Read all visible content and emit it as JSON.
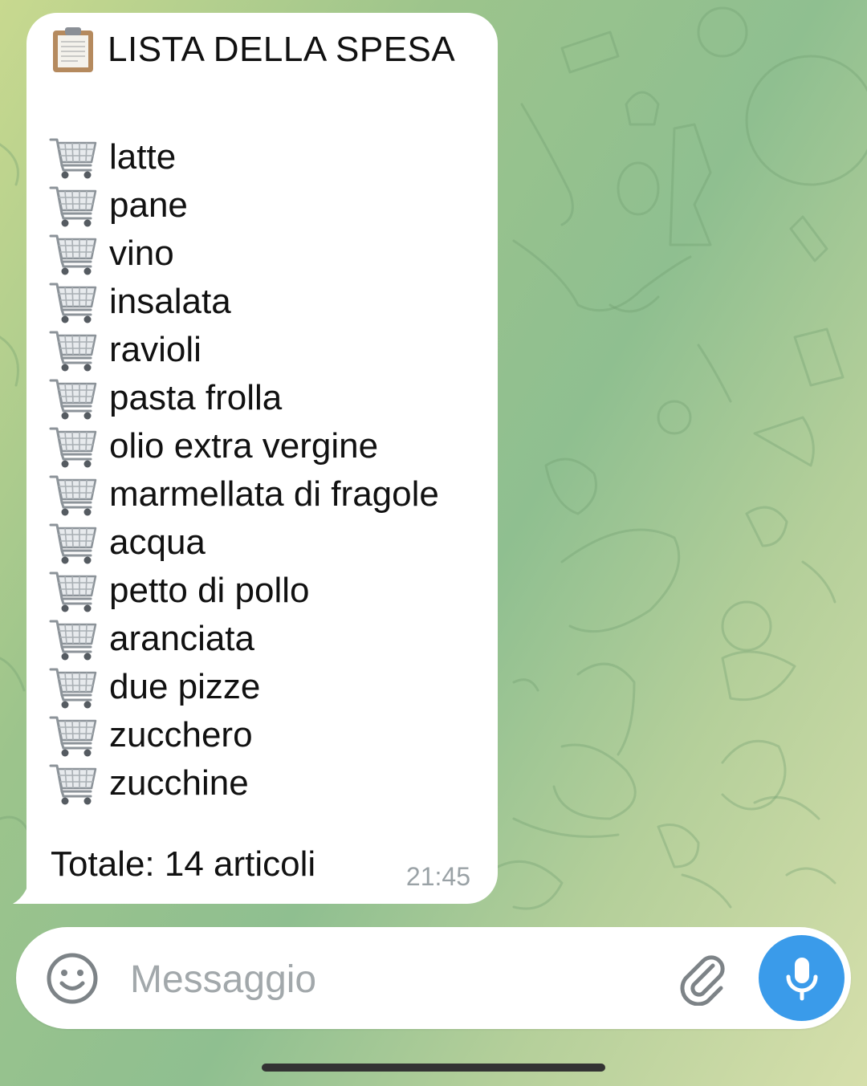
{
  "message": {
    "title": "LISTA DELLA SPESA",
    "title_icon": "clipboard-icon",
    "item_icon": "shopping-cart-icon",
    "items": [
      "latte",
      "pane",
      "vino",
      "insalata",
      "ravioli",
      "pasta frolla",
      "olio extra vergine",
      "marmellata di fragole",
      "acqua",
      "petto di pollo",
      "aranciata",
      "due pizze",
      "zucchero",
      "zucchine"
    ],
    "total": "Totale: 14 articoli",
    "time": "21:45"
  },
  "composer": {
    "placeholder": "Messaggio",
    "emoji_icon": "smiley-icon",
    "attach_icon": "paperclip-icon",
    "send_icon": "microphone-icon"
  },
  "colors": {
    "bubble_bg": "#ffffff",
    "mic_button": "#3a9bea",
    "timestamp": "#9aa2a6",
    "placeholder": "#a2a8ab"
  }
}
